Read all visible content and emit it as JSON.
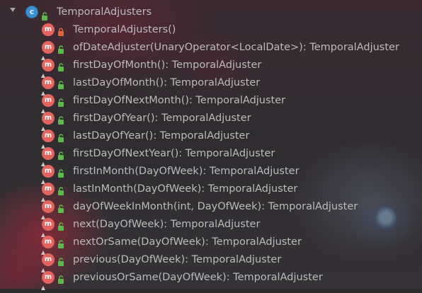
{
  "tree": {
    "root": {
      "expanded": true,
      "icon": "class-icon",
      "icon_letter": "c",
      "visibility": "public",
      "label": "TemporalAdjusters"
    },
    "members": [
      {
        "icon_letter": "m",
        "visibility": "private",
        "static": false,
        "label": "TemporalAdjusters()"
      },
      {
        "icon_letter": "m",
        "visibility": "public",
        "static": true,
        "label": "ofDateAdjuster(UnaryOperator<LocalDate>): TemporalAdjuster"
      },
      {
        "icon_letter": "m",
        "visibility": "public",
        "static": true,
        "label": "firstDayOfMonth(): TemporalAdjuster"
      },
      {
        "icon_letter": "m",
        "visibility": "public",
        "static": true,
        "label": "lastDayOfMonth(): TemporalAdjuster"
      },
      {
        "icon_letter": "m",
        "visibility": "public",
        "static": true,
        "label": "firstDayOfNextMonth(): TemporalAdjuster"
      },
      {
        "icon_letter": "m",
        "visibility": "public",
        "static": true,
        "label": "firstDayOfYear(): TemporalAdjuster"
      },
      {
        "icon_letter": "m",
        "visibility": "public",
        "static": true,
        "label": "lastDayOfYear(): TemporalAdjuster"
      },
      {
        "icon_letter": "m",
        "visibility": "public",
        "static": true,
        "label": "firstDayOfNextYear(): TemporalAdjuster"
      },
      {
        "icon_letter": "m",
        "visibility": "public",
        "static": true,
        "label": "firstInMonth(DayOfWeek): TemporalAdjuster"
      },
      {
        "icon_letter": "m",
        "visibility": "public",
        "static": true,
        "label": "lastInMonth(DayOfWeek): TemporalAdjuster"
      },
      {
        "icon_letter": "m",
        "visibility": "public",
        "static": true,
        "label": "dayOfWeekInMonth(int, DayOfWeek): TemporalAdjuster"
      },
      {
        "icon_letter": "m",
        "visibility": "public",
        "static": true,
        "label": "next(DayOfWeek): TemporalAdjuster"
      },
      {
        "icon_letter": "m",
        "visibility": "public",
        "static": true,
        "label": "nextOrSame(DayOfWeek): TemporalAdjuster"
      },
      {
        "icon_letter": "m",
        "visibility": "public",
        "static": true,
        "label": "previous(DayOfWeek): TemporalAdjuster"
      },
      {
        "icon_letter": "m",
        "visibility": "public",
        "static": true,
        "label": "previousOrSame(DayOfWeek): TemporalAdjuster"
      }
    ]
  },
  "colors": {
    "text": "#bbbbbb",
    "method_icon": "#e3645f",
    "class_icon": "#3d8fd1",
    "public_lock": "#5fb84e",
    "private_lock": "#e06343",
    "background": "#2b2b2b"
  }
}
